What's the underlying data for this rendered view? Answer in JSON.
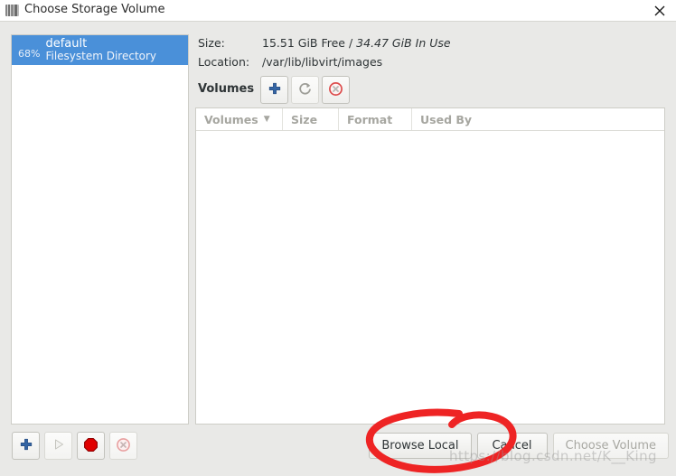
{
  "window": {
    "title": "Choose Storage Volume",
    "app_icon": "virt-manager-icon",
    "close_icon": "close-icon",
    "bg_color": "#e9e9e7",
    "selection_color": "#4a90d9"
  },
  "pool_list": {
    "items": [
      {
        "percent": "68%",
        "name": "default",
        "type": "Filesystem Directory",
        "selected": true
      }
    ],
    "toolbar": [
      {
        "name": "add-pool-button",
        "icon": "plus-icon",
        "enabled": true
      },
      {
        "name": "start-pool-button",
        "icon": "play-icon",
        "enabled": false
      },
      {
        "name": "stop-pool-button",
        "icon": "stop-icon",
        "enabled": true
      },
      {
        "name": "delete-pool-button",
        "icon": "circle-x-icon",
        "enabled": false
      }
    ]
  },
  "details": {
    "size_label": "Size:",
    "size_free": "15.51 GiB Free",
    "size_separator": " / ",
    "size_in_use": "34.47 GiB In Use",
    "location_label": "Location:",
    "location_value": "/var/lib/libvirt/images"
  },
  "volumes": {
    "heading": "Volumes",
    "toolbar": [
      {
        "name": "add-volume-button",
        "icon": "plus-icon",
        "enabled": true
      },
      {
        "name": "refresh-volume-button",
        "icon": "refresh-icon",
        "enabled": false
      },
      {
        "name": "delete-volume-button",
        "icon": "circle-x-icon",
        "enabled": true
      }
    ],
    "columns": [
      {
        "label": "Volumes",
        "sorted": true,
        "caret": "▼"
      },
      {
        "label": "Size",
        "sorted": false,
        "caret": ""
      },
      {
        "label": "Format",
        "sorted": false,
        "caret": ""
      },
      {
        "label": "Used By",
        "sorted": false,
        "caret": ""
      }
    ],
    "rows": []
  },
  "dialog_buttons": [
    {
      "label": "Browse Local",
      "name": "browse-local-button",
      "enabled": true
    },
    {
      "label": "Cancel",
      "name": "cancel-button",
      "enabled": true
    },
    {
      "label": "Choose Volume",
      "name": "choose-volume-button",
      "enabled": false
    }
  ],
  "annotation": {
    "shape": "hand-drawn-red-ellipse",
    "color": "#ee2424",
    "targets": "Browse Local"
  },
  "watermark": {
    "text": "https://blog.csdn.net/K__King"
  }
}
